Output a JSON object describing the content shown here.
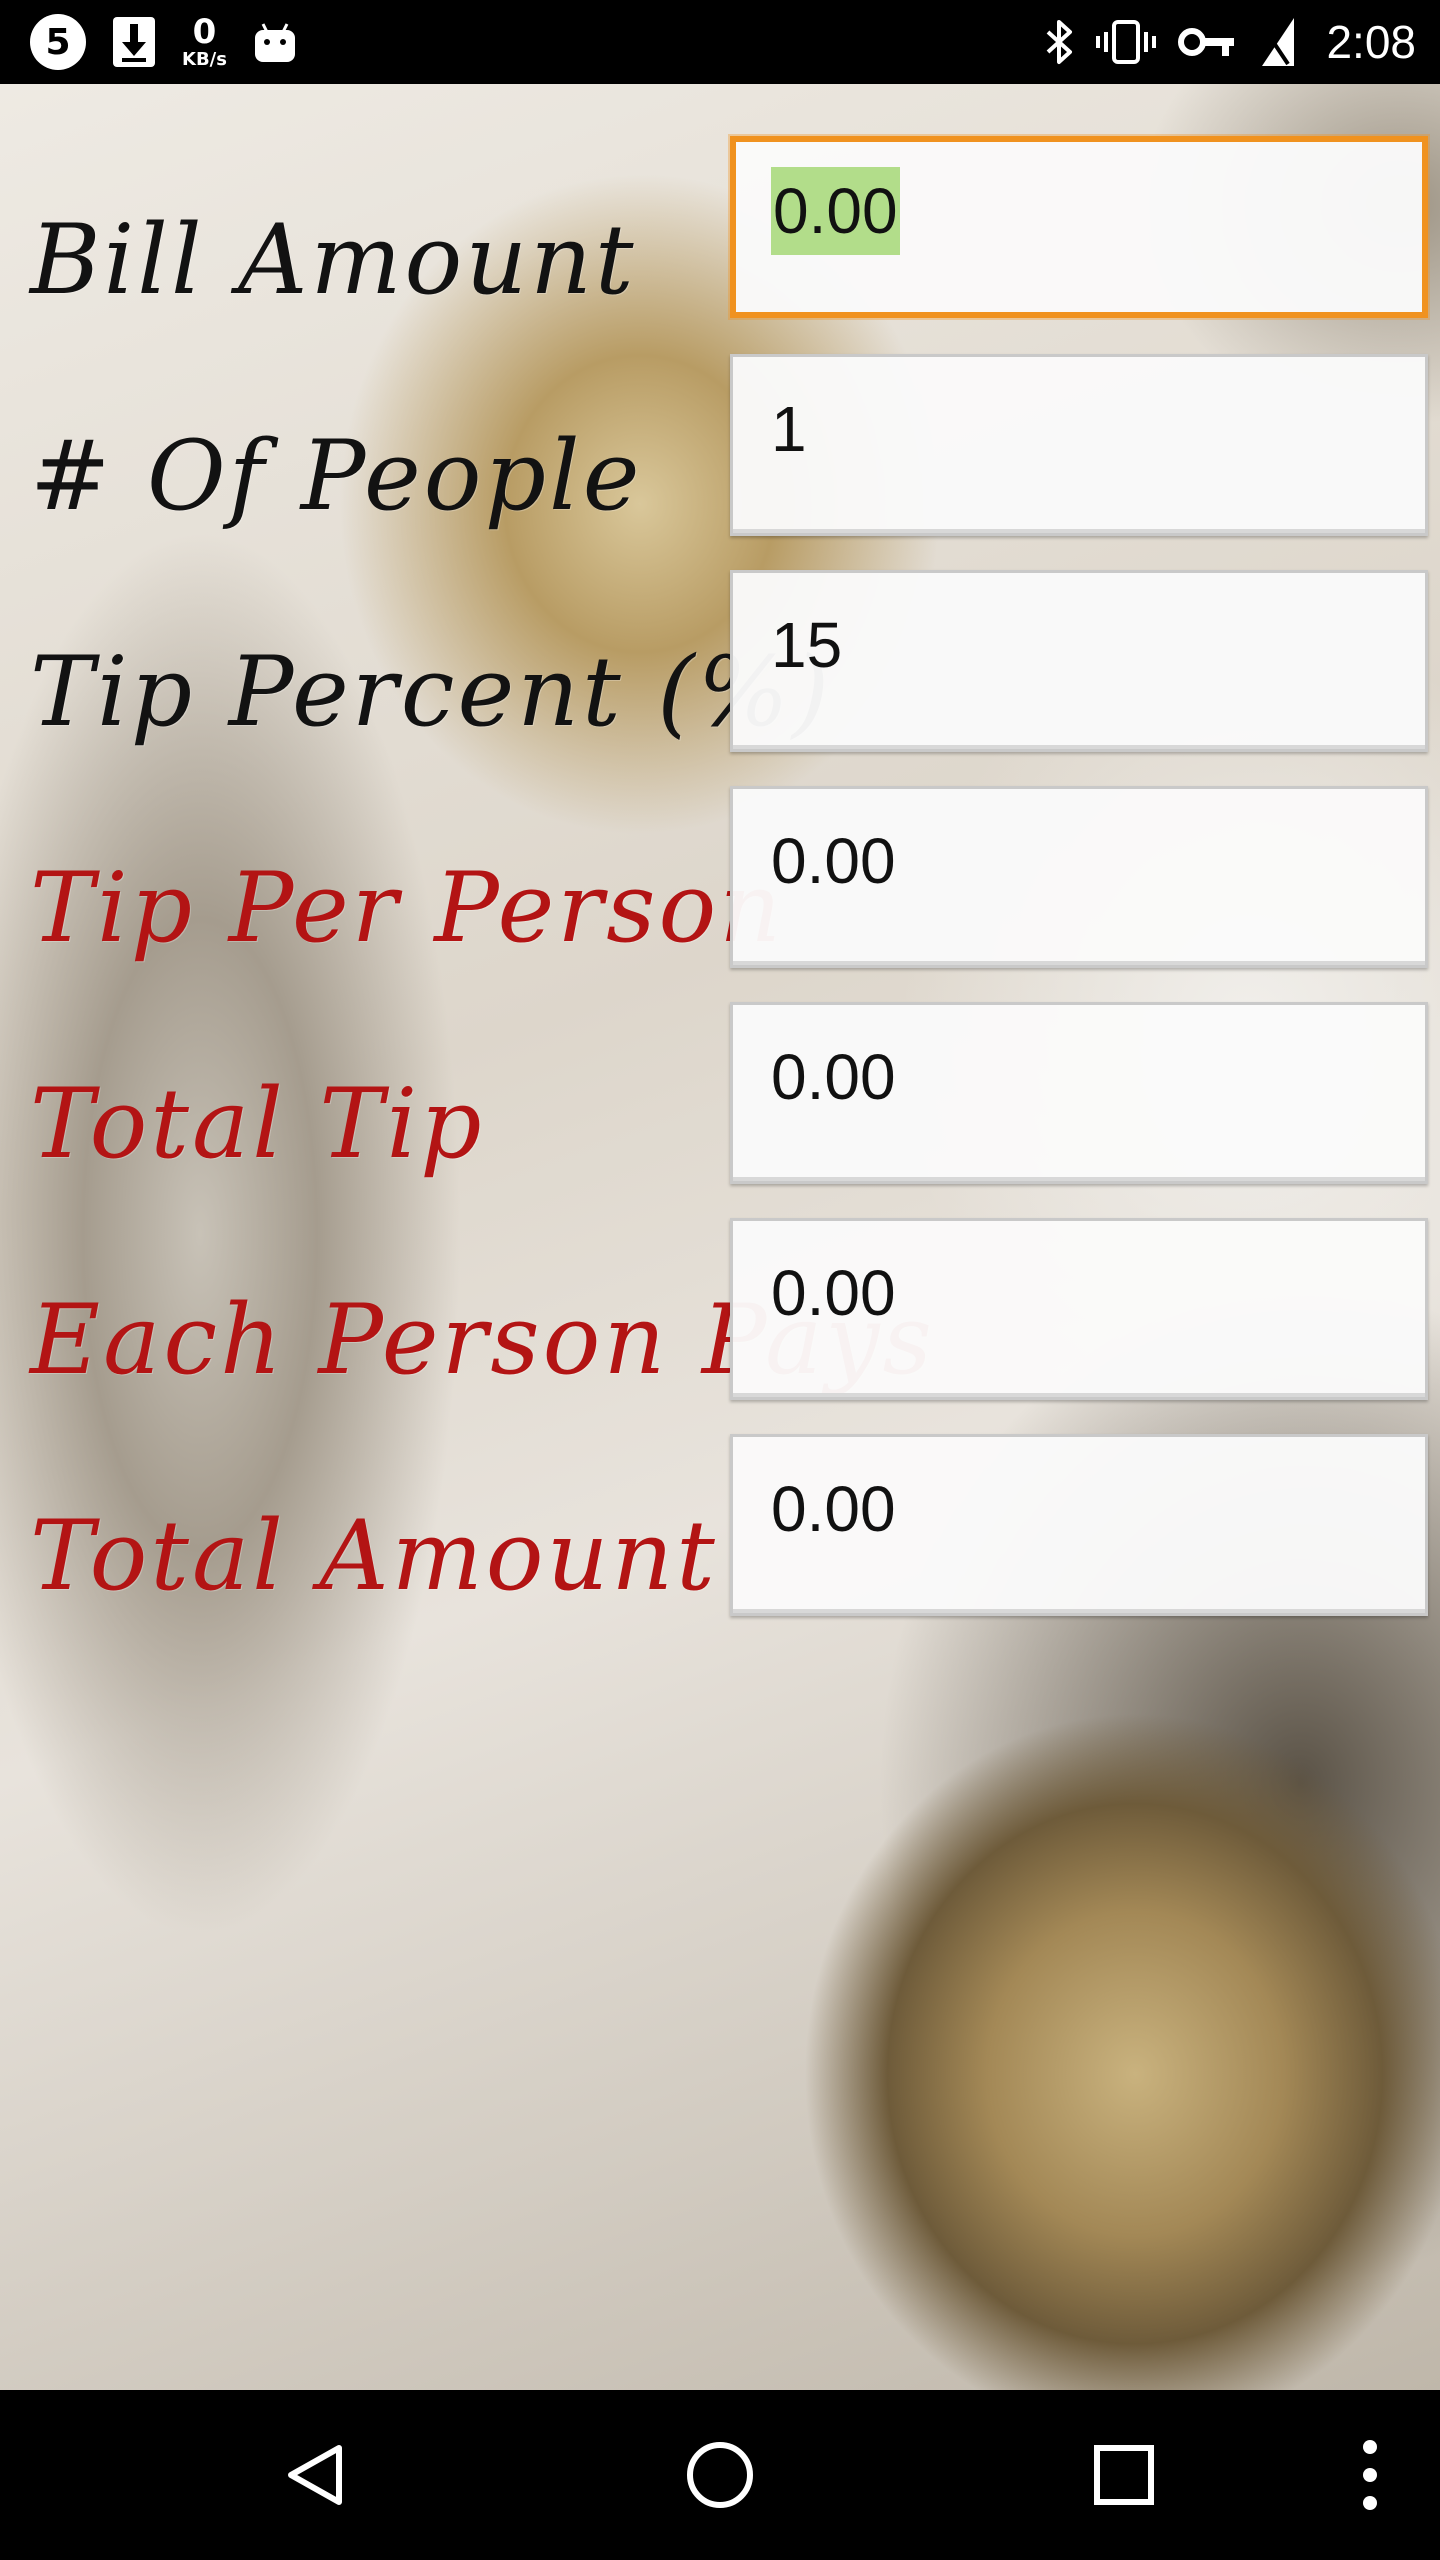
{
  "status_bar": {
    "time": "2:08",
    "circle_badge": "5",
    "net_speed_value": "0",
    "net_speed_unit": "KB/s",
    "left_icons": [
      "app-5-icon",
      "download-icon",
      "net-speed-indicator",
      "android-icon"
    ],
    "right_icons": [
      "bluetooth-icon",
      "vibrate-icon",
      "vpn-key-icon",
      "signal-off-icon"
    ]
  },
  "form": {
    "rows": [
      {
        "label": "Bill Amount",
        "value": "0.00",
        "label_color": "#121212",
        "focused": true,
        "selected": true
      },
      {
        "label": "# Of People",
        "value": "1",
        "label_color": "#121212"
      },
      {
        "label": "Tip Percent (%)",
        "value": "15",
        "label_color": "#121212"
      },
      {
        "label": "Tip Per Person",
        "value": "0.00",
        "label_color": "#b31414"
      },
      {
        "label": "Total Tip",
        "value": "0.00",
        "label_color": "#b31414"
      },
      {
        "label": "Each Person Pays",
        "value": "0.00",
        "label_color": "#b31414"
      },
      {
        "label": "Total Amount",
        "value": "0.00",
        "label_color": "#b31414"
      }
    ]
  },
  "colors": {
    "focus_border": "#f0921f",
    "selection_highlight": "#b2dd8a",
    "input_label": "#121212",
    "result_label": "#b31414"
  },
  "nav_bar": {
    "buttons": [
      "back-icon",
      "home-icon",
      "recents-icon",
      "overflow-menu-icon"
    ]
  }
}
